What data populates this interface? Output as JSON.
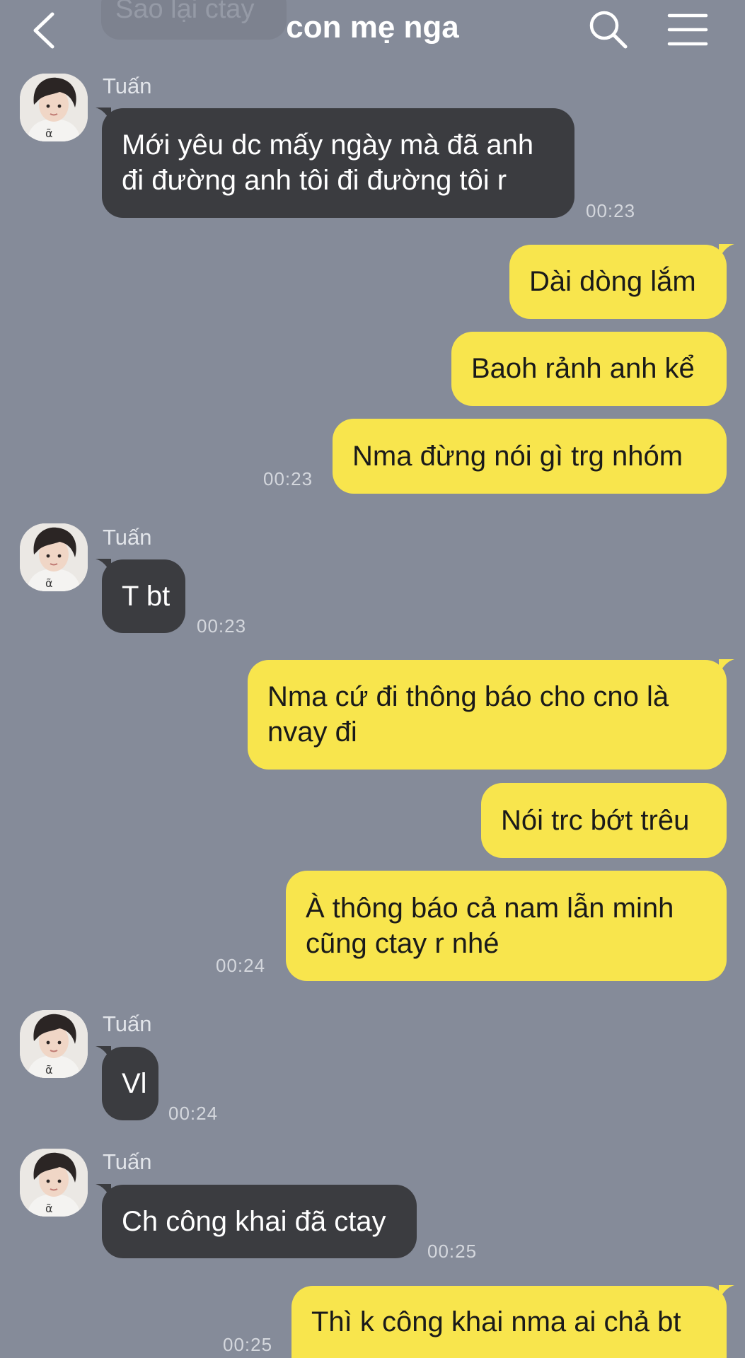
{
  "header": {
    "title": "con mẹ nga",
    "previous_message_preview": "Sao lại ctay"
  },
  "colors": {
    "background": "#858b99",
    "incoming_bubble": "#3b3c40",
    "outgoing_bubble": "#f8e54d"
  },
  "messages": [
    {
      "sender": "Tuấn",
      "lines": [
        "Mới yêu dc mấy ngày mà đã anh",
        "đi đường anh tôi đi đường tôi r"
      ],
      "time": "00:23"
    },
    {
      "lines": [
        "Dài dòng lắm"
      ]
    },
    {
      "lines": [
        "Baoh rảnh anh kể"
      ]
    },
    {
      "lines": [
        "Nma đừng nói gì trg nhóm"
      ],
      "time": "00:23"
    },
    {
      "sender": "Tuấn",
      "lines": [
        "T bt"
      ],
      "time": "00:23"
    },
    {
      "lines": [
        "Nma cứ đi thông báo cho cno là",
        "nvay đi"
      ]
    },
    {
      "lines": [
        "Nói trc bớt trêu"
      ]
    },
    {
      "lines": [
        "À thông báo cả nam lẫn minh",
        "cũng ctay r nhé"
      ],
      "time": "00:24"
    },
    {
      "sender": "Tuấn",
      "lines": [
        "Vl"
      ],
      "time": "00:24"
    },
    {
      "sender": "Tuấn",
      "lines": [
        "Ch công khai đã ctay"
      ],
      "time": "00:25"
    },
    {
      "lines": [
        "Thì k công khai nma ai chả bt"
      ],
      "time": "00:25"
    }
  ]
}
